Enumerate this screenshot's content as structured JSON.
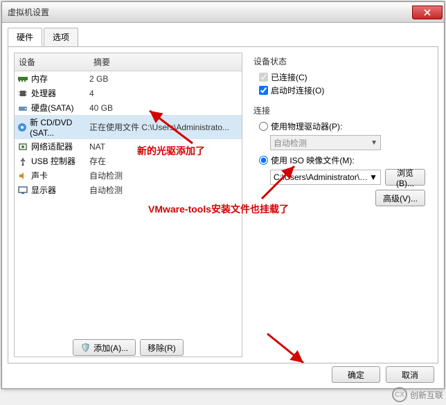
{
  "window": {
    "title": "虚拟机设置"
  },
  "tabs": {
    "hardware": "硬件",
    "options": "选项"
  },
  "columns": {
    "device": "设备",
    "summary": "摘要"
  },
  "devices": [
    {
      "name": "内存",
      "summary": "2 GB"
    },
    {
      "name": "处理器",
      "summary": "4"
    },
    {
      "name": "硬盘(SATA)",
      "summary": "40 GB"
    },
    {
      "name": "新 CD/DVD (SAT...",
      "summary": "正在使用文件 C:\\Users\\Administrato..."
    },
    {
      "name": "网络适配器",
      "summary": "NAT"
    },
    {
      "name": "USB 控制器",
      "summary": "存在"
    },
    {
      "name": "声卡",
      "summary": "自动检测"
    },
    {
      "name": "显示器",
      "summary": "自动检测"
    }
  ],
  "status": {
    "title": "设备状态",
    "connected": "已连接(C)",
    "connect_at_power": "启动时连接(O)"
  },
  "connection": {
    "title": "连接",
    "physical": "使用物理驱动器(P):",
    "auto_detect": "自动检测",
    "iso": "使用 ISO 映像文件(M):",
    "path": "C:\\Users\\Administrator\\Desk",
    "browse": "浏览(B)...",
    "advanced": "高级(V)..."
  },
  "buttons": {
    "add": "添加(A)...",
    "remove": "移除(R)",
    "ok": "确定",
    "cancel": "取消"
  },
  "annotations": {
    "a1": "新的光驱添加了",
    "a2": "VMware-tools安装文件也挂载了"
  },
  "watermark": {
    "text": "创新互联"
  }
}
